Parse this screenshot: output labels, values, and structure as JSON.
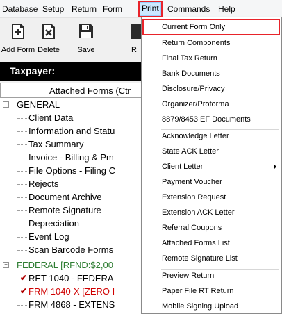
{
  "menubar": {
    "items": [
      {
        "label": "Database"
      },
      {
        "label": "Setup"
      },
      {
        "label": "Return"
      },
      {
        "label": "Form"
      },
      {
        "label": "Print"
      },
      {
        "label": "Commands"
      },
      {
        "label": "Help"
      }
    ]
  },
  "toolbar": {
    "buttons": [
      {
        "label": "Add Form",
        "icon": "add-form-icon"
      },
      {
        "label": "Delete",
        "icon": "delete-icon"
      },
      {
        "label": "Save",
        "icon": "save-icon"
      },
      {
        "label": "R",
        "icon": "partial-icon"
      }
    ]
  },
  "taxpayer_label": "Taxpayer:",
  "tab_header": "Attached Forms (Ctr",
  "tree": {
    "general": {
      "label": "GENERAL",
      "expander": "−"
    },
    "general_children": [
      "Client Data",
      "Information and Statu",
      "Tax Summary",
      "Invoice - Billing & Pm",
      "File Options - Filing C",
      "Rejects",
      "Document Archive",
      "Remote Signature",
      "Depreciation",
      "Event Log",
      "Scan Barcode Forms"
    ],
    "federal": {
      "label": "FEDERAL [RFND:$2,00",
      "expander": "−"
    },
    "federal_children": [
      {
        "label": "RET 1040 - FEDERA",
        "check": "✔",
        "color": "#000000"
      },
      {
        "label": "FRM 1040-X [ZERO I",
        "check": "✔",
        "color": "#d00000"
      },
      {
        "label": "FRM 4868 - EXTENS",
        "check": "",
        "color": "#000000"
      }
    ]
  },
  "print_menu": {
    "groups": [
      [
        "Current Form Only",
        "Return Components",
        "Final Tax Return",
        "Bank Documents",
        "Disclosure/Privacy",
        "Organizer/Proforma",
        "8879/8453 EF Documents"
      ],
      [
        "Acknowledge Letter",
        "State ACK Letter",
        "Client Letter",
        "Payment Voucher",
        "Extension Request",
        "Extension ACK Letter",
        "Referral Coupons",
        "Attached Forms List",
        "Remote Signature List"
      ],
      [
        "Preview Return",
        "Paper File RT Return",
        "Mobile Signing Upload"
      ]
    ],
    "highlighted": "Current Form Only",
    "submenu_item": "Client Letter"
  },
  "colors": {
    "highlight_outline": "#e8232a",
    "federal_text": "#2e7d32",
    "error_text": "#d00000"
  }
}
